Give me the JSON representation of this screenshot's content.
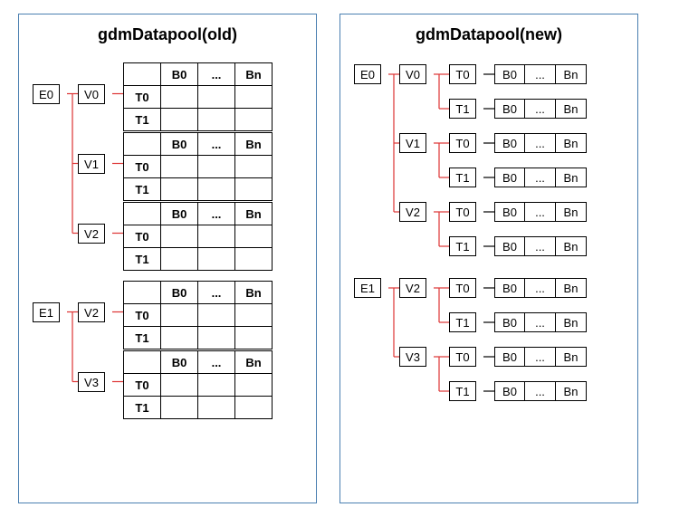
{
  "old": {
    "title": "gdmDatapool(old)",
    "headers": [
      "B0",
      "...",
      "Bn"
    ],
    "groups": [
      {
        "e": "E0",
        "vs": [
          {
            "v": "V0",
            "ts": [
              "T0",
              "T1"
            ]
          },
          {
            "v": "V1",
            "ts": [
              "T0",
              "T1"
            ]
          },
          {
            "v": "V2",
            "ts": [
              "T0",
              "T1"
            ]
          }
        ]
      },
      {
        "e": "E1",
        "vs": [
          {
            "v": "V2",
            "ts": [
              "T0",
              "T1"
            ]
          },
          {
            "v": "V3",
            "ts": [
              "T0",
              "T1"
            ]
          }
        ]
      }
    ]
  },
  "new": {
    "title": "gdmDatapool(new)",
    "cells": [
      "B0",
      "...",
      "Bn"
    ],
    "groups": [
      {
        "e": "E0",
        "vs": [
          {
            "v": "V0",
            "ts": [
              "T0",
              "T1"
            ]
          },
          {
            "v": "V1",
            "ts": [
              "T0",
              "T1"
            ]
          },
          {
            "v": "V2",
            "ts": [
              "T0",
              "T1"
            ]
          }
        ]
      },
      {
        "e": "E1",
        "vs": [
          {
            "v": "V2",
            "ts": [
              "T0",
              "T1"
            ]
          },
          {
            "v": "V3",
            "ts": [
              "T0",
              "T1"
            ]
          }
        ]
      }
    ]
  }
}
